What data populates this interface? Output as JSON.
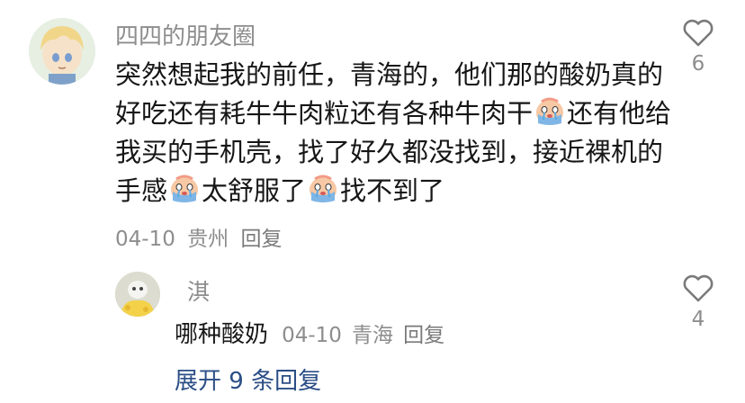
{
  "comment": {
    "username": "四四的朋友圈",
    "text_segments": [
      "突然想起我的前任，青海的，他们那的酸奶真的好吃还有耗牛牛肉粒还有各种牛肉干",
      "还有他给我买的手机壳，找了好久都没找到，接近裸机的手感",
      "太舒服了",
      "找不到了"
    ],
    "date": "04-10",
    "location": "贵州",
    "reply_label": "回复",
    "like_count": "6",
    "emoji_name": "crying-face-emoji"
  },
  "reply": {
    "username": "淇",
    "text": "哪种酸奶",
    "date": "04-10",
    "location": "青海",
    "reply_label": "回复",
    "like_count": "4"
  },
  "expand_label": "展开 9 条回复",
  "colors": {
    "expand_link": "#2b4e86",
    "meta_gray": "#8d8d8d",
    "text": "#161616"
  }
}
